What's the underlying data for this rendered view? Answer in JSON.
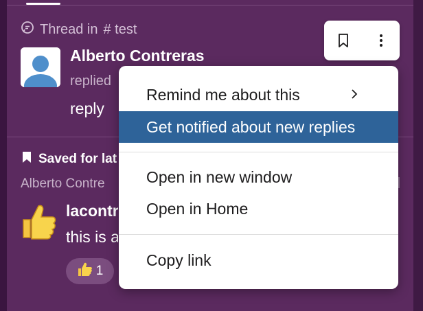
{
  "thread": {
    "header_label": "Thread in",
    "channel": "# test",
    "author": "Alberto Contreras",
    "replied_label": "replied",
    "message": "reply"
  },
  "saved": {
    "header_label": "Saved for lat",
    "sub_label": "Alberto Contre",
    "author": "lacontr",
    "message": "this is a",
    "reaction_count": "1"
  },
  "context_menu": {
    "items": [
      {
        "label": "Remind me about this",
        "has_submenu": true
      },
      {
        "label": "Get notified about new replies",
        "selected": true
      },
      {
        "label": "Open in new window"
      },
      {
        "label": "Open in Home"
      },
      {
        "label": "Copy link"
      }
    ]
  },
  "action_bar": {
    "icons": [
      "bookmark-icon",
      "more-vertical-icon"
    ]
  },
  "colors": {
    "background": "#5b2a5f",
    "menu_highlight": "#2e6399",
    "menu_bg": "#ffffff"
  }
}
